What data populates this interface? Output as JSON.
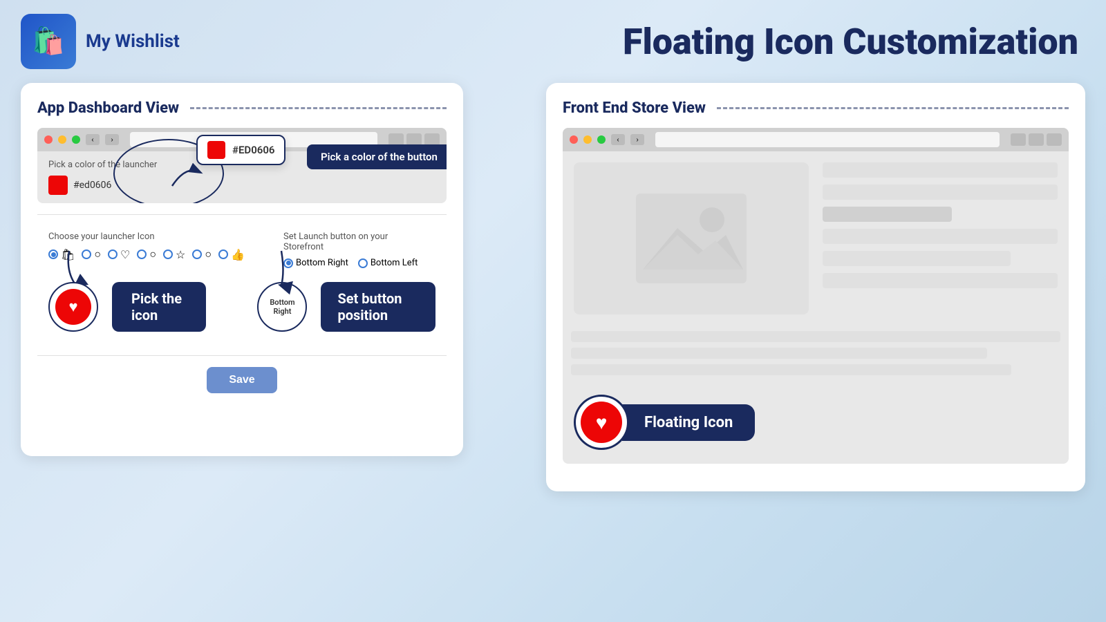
{
  "header": {
    "logo_alt": "My Wishlist logo",
    "app_name": "My Wishlist",
    "page_title": "Floating Icon Customization"
  },
  "dashboard_panel": {
    "title": "App Dashboard View",
    "browser": {
      "url_placeholder": "",
      "dots": [
        "red",
        "yellow",
        "green"
      ]
    },
    "color_section": {
      "label": "Pick a color of the launcher",
      "hex_value": "#ed0606",
      "hex_display": "#ED0606",
      "callout_label": "Pick a color of the button"
    },
    "icon_section": {
      "label": "Choose your launcher Icon",
      "icons": [
        "circle",
        "heart",
        "circle-outline",
        "star",
        "circle-outline2",
        "thumbs-up"
      ],
      "selected_index": 0
    },
    "position_section": {
      "label": "Set Launch button on your Storefront",
      "options": [
        "Bottom Right",
        "Bottom Left"
      ],
      "selected": "Bottom Right",
      "callout_label": "Set button position"
    },
    "pick_icon_label": "Pick the icon",
    "save_button": "Save"
  },
  "store_panel": {
    "title": "Front End Store View",
    "floating_icon_label": "Floating Icon"
  },
  "annotations": {
    "color_circle_label": "#ED0606",
    "pick_icon_circle_label": "Bottom Right",
    "arrows": [
      "color-to-callout",
      "icon-to-callout",
      "position-to-callout"
    ]
  }
}
